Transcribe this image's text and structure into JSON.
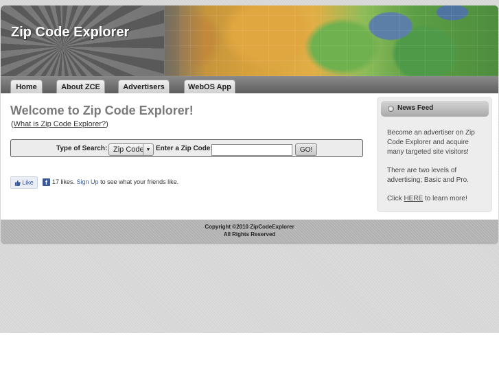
{
  "header": {
    "site_title": "Zip Code Explorer"
  },
  "nav": {
    "items": [
      {
        "label": "Home"
      },
      {
        "label": "About ZCE"
      },
      {
        "label": "Advertisers"
      },
      {
        "label": "WebOS App"
      }
    ]
  },
  "main": {
    "welcome_title": "Welcome to Zip Code Explorer!",
    "what_is_paren_open": "(",
    "what_is_link": "What is Zip Code Explorer?",
    "what_is_paren_close": ")",
    "search": {
      "type_label": "Type of Search:",
      "type_selected": "Zip Code",
      "zip_label": "Enter a Zip Code:",
      "zip_value": "",
      "go_label": "GO!"
    },
    "facebook": {
      "like_label": "Like",
      "likes_text": "17 likes.",
      "signup_link": "Sign Up",
      "suffix_text": "to see what your friends like."
    }
  },
  "sidebar": {
    "title": "News Feed",
    "para1": "Become an advertiser on Zip Code Explorer and acquire many targeted site visitors!",
    "para2": "There are two levels of advertising; Basic and Pro.",
    "para3_prefix": "Click",
    "para3_link": "HERE",
    "para3_suffix": "to learn more!"
  },
  "footer": {
    "copyright": "Copyright ©2010 ZipCodeExplorer",
    "rights": "All Rights Reserved"
  },
  "colors": {
    "welcome_text": "#7a7a7a",
    "facebook_blue": "#3b5998",
    "nav_bar": "#6e6e6e"
  },
  "icons": {
    "dropdown": "chevron-down-icon",
    "facebook": "facebook-icon",
    "thumbs_up": "thumbs-up-icon",
    "news_bullet": "bullet-icon"
  }
}
